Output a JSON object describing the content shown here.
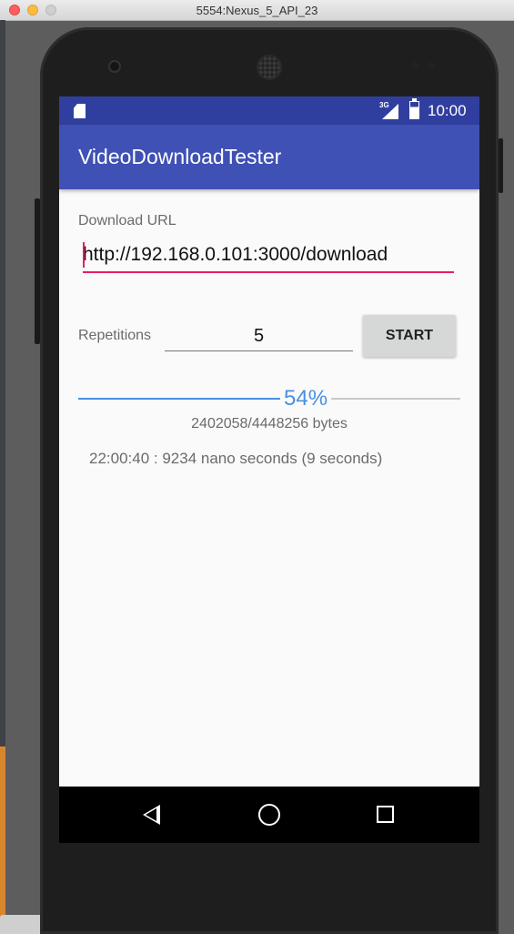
{
  "window": {
    "title": "5554:Nexus_5_API_23"
  },
  "status_bar": {
    "time": "10:00",
    "network": "3G",
    "icons": [
      "sd-card-icon",
      "signal-icon",
      "battery-icon"
    ]
  },
  "app": {
    "title": "VideoDownloadTester"
  },
  "form": {
    "url_label": "Download URL",
    "url_value": "http://192.168.0.101:3000/download",
    "repetitions_label": "Repetitions",
    "repetitions_value": "5",
    "start_label": "START"
  },
  "progress": {
    "fraction": 0.54,
    "percent_label": "54%",
    "bytes_label": "2402058/4448256 bytes"
  },
  "log": {
    "line": "22:00:40 : 9234 nano seconds (9 seconds)"
  },
  "nav": {
    "icons": [
      "back-icon",
      "home-icon",
      "recents-icon"
    ]
  },
  "colors": {
    "status_bar": "#303f9f",
    "app_bar": "#3f51b5",
    "accent": "#e91e63",
    "progress": "#4a90e2"
  }
}
